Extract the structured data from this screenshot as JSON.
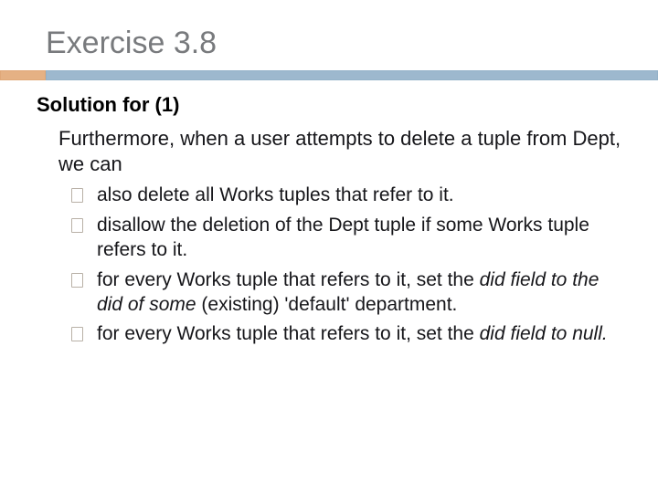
{
  "title": "Exercise 3.8",
  "subheading": "Solution for (1)",
  "intro": "Furthermore, when a user attempts to delete a tuple from Dept, we can",
  "bullets": [
    {
      "plain": "also delete all Works tuples that refer to it."
    },
    {
      "plain": "disallow the deletion of the Dept tuple if some Works tuple refers to it."
    },
    {
      "prefix": "for every Works tuple that refers to it, set the ",
      "italic": "did field to the did of some",
      "suffix": " (existing) 'default' department."
    },
    {
      "prefix": "for every Works tuple that refers to it, set the ",
      "italic": "did field to null.",
      "suffix": ""
    }
  ]
}
